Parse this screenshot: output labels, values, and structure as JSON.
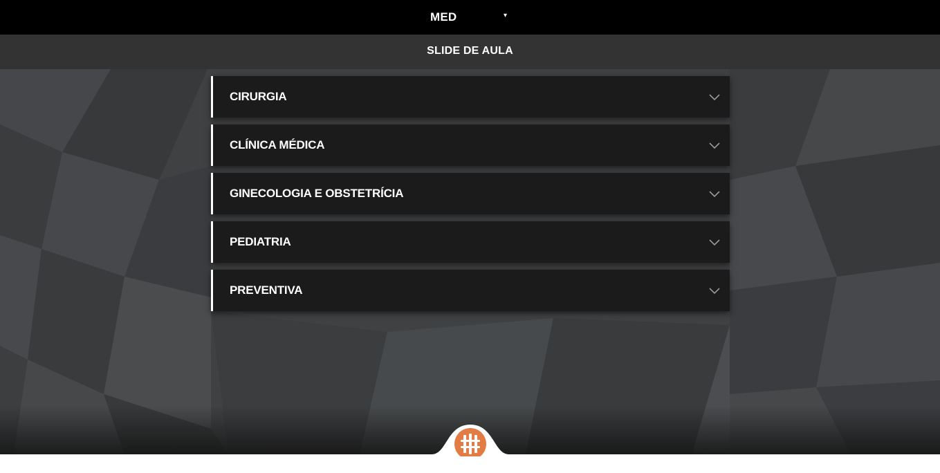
{
  "topbar": {
    "course_label": "MED",
    "caret": "▾"
  },
  "subbar": {
    "title": "SLIDE DE AULA"
  },
  "accordion": {
    "items": [
      {
        "label": "CIRURGIA"
      },
      {
        "label": "CLÍNICA MÉDICA"
      },
      {
        "label": "GINECOLOGIA E OBSTETRÍCIA"
      },
      {
        "label": "PEDIATRIA"
      },
      {
        "label": "PREVENTIVA"
      }
    ]
  },
  "colors": {
    "topbar": "#000000",
    "subbar": "#333333",
    "item_bg": "#1b1b1c",
    "item_accent": "#ffffff",
    "logo_orange": "#e37b45"
  },
  "icons": {
    "chevron": "chevron-down-icon",
    "logo": "medical-cross-logo"
  }
}
